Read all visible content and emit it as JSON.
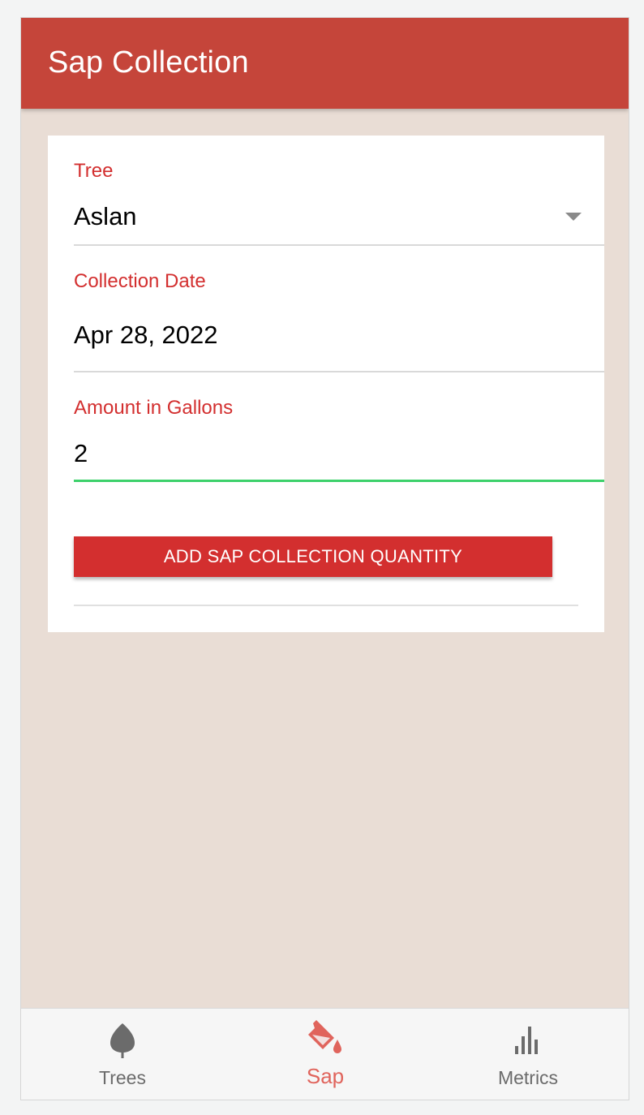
{
  "app_bar": {
    "title": "Sap Collection"
  },
  "form": {
    "tree": {
      "label": "Tree",
      "value": "Aslan"
    },
    "collection_date": {
      "label": "Collection Date",
      "value": "Apr 28, 2022"
    },
    "amount": {
      "label": "Amount in Gallons",
      "value": "2"
    },
    "submit_label": "ADD SAP COLLECTION QUANTITY"
  },
  "bottom_nav": {
    "items": [
      {
        "label": "Trees",
        "icon": "leaf-icon",
        "active": false
      },
      {
        "label": "Sap",
        "icon": "paint-bucket-icon",
        "active": true
      },
      {
        "label": "Metrics",
        "icon": "bar-chart-icon",
        "active": false
      }
    ]
  },
  "colors": {
    "app_bar": "#c5453a",
    "accent": "#d32f2f",
    "active_field": "#3dd16b",
    "background": "#e9ddd5",
    "active_nav": "#e0645c",
    "inactive_nav": "#6b6b6b"
  }
}
